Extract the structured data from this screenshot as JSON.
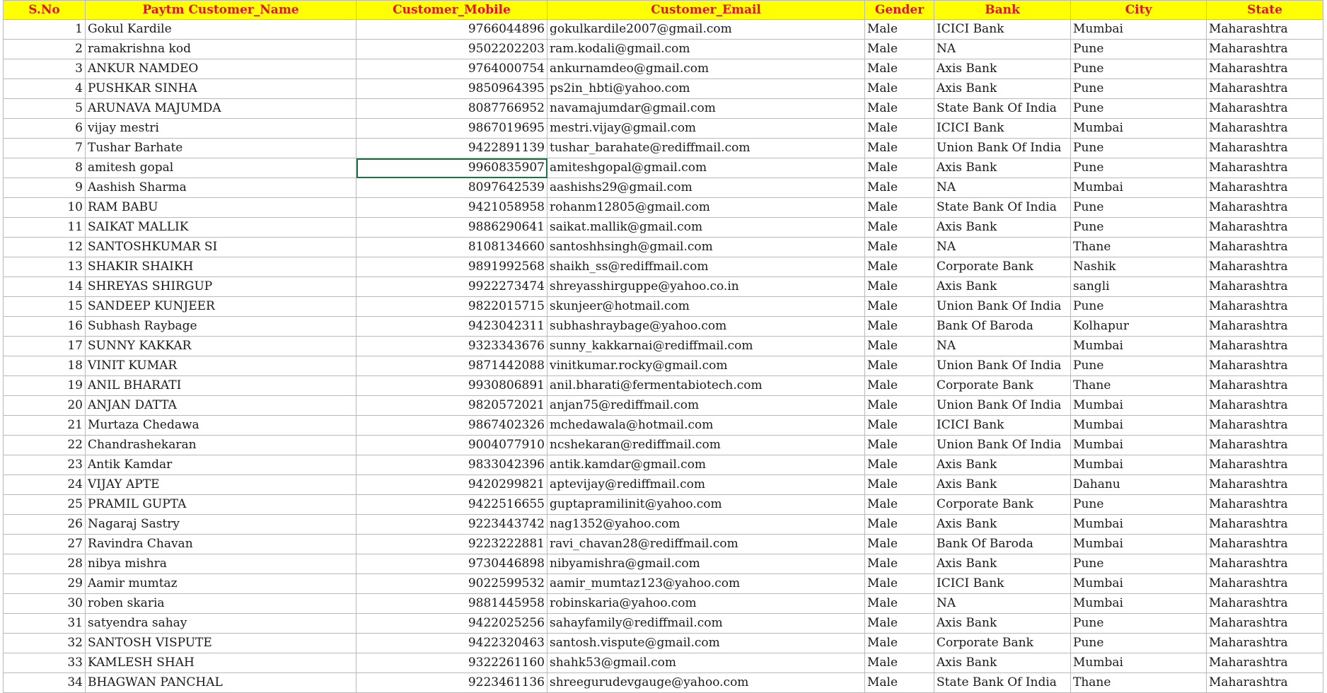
{
  "headers": [
    "S.No",
    "Paytm Customer_Name",
    "Customer_Mobile",
    "Customer_Email",
    "Gender",
    "Bank",
    "City",
    "State"
  ],
  "selected_cell": {
    "row": 8,
    "col": 2
  },
  "rows": [
    [
      "1",
      "Gokul Kardile",
      "9766044896",
      "gokulkardile2007@gmail.com",
      "Male",
      "ICICI Bank",
      "Mumbai",
      "Maharashtra"
    ],
    [
      "2",
      "ramakrishna kod",
      "9502202203",
      "ram.kodali@gmail.com",
      "Male",
      "NA",
      "Pune",
      "Maharashtra"
    ],
    [
      "3",
      "ANKUR NAMDEO",
      "9764000754",
      "ankurnamdeo@gmail.com",
      "Male",
      "Axis Bank",
      "Pune",
      "Maharashtra"
    ],
    [
      "4",
      "PUSHKAR SINHA",
      "9850964395",
      "ps2in_hbti@yahoo.com",
      "Male",
      "Axis Bank",
      "Pune",
      "Maharashtra"
    ],
    [
      "5",
      "ARUNAVA MAJUMDA",
      "8087766952",
      "navamajumdar@gmail.com",
      "Male",
      "State Bank Of India",
      "Pune",
      "Maharashtra"
    ],
    [
      "6",
      "vijay mestri",
      "9867019695",
      "mestri.vijay@gmail.com",
      "Male",
      "ICICI Bank",
      "Mumbai",
      "Maharashtra"
    ],
    [
      "7",
      "Tushar Barhate",
      "9422891139",
      "tushar_barahate@rediffmail.com",
      "Male",
      "Union Bank Of India",
      "Pune",
      "Maharashtra"
    ],
    [
      "8",
      "amitesh gopal",
      "9960835907",
      "amiteshgopal@gmail.com",
      "Male",
      "Axis Bank",
      "Pune",
      "Maharashtra"
    ],
    [
      "9",
      "Aashish Sharma",
      "8097642539",
      "aashishs29@gmail.com",
      "Male",
      "NA",
      "Mumbai",
      "Maharashtra"
    ],
    [
      "10",
      "RAM BABU",
      "9421058958",
      "rohanm12805@gmail.com",
      "Male",
      "State Bank Of India",
      "Pune",
      "Maharashtra"
    ],
    [
      "11",
      "SAIKAT MALLIK",
      "9886290641",
      "saikat.mallik@gmail.com",
      "Male",
      "Axis Bank",
      "Pune",
      "Maharashtra"
    ],
    [
      "12",
      "SANTOSHKUMAR SI",
      "8108134660",
      "santoshhsingh@gmail.com",
      "Male",
      "NA",
      "Thane",
      "Maharashtra"
    ],
    [
      "13",
      "SHAKIR SHAIKH",
      "9891992568",
      "shaikh_ss@rediffmail.com",
      "Male",
      "Corporate Bank",
      "Nashik",
      "Maharashtra"
    ],
    [
      "14",
      "SHREYAS SHIRGUP",
      "9922273474",
      "shreyasshirguppe@yahoo.co.in",
      "Male",
      "Axis Bank",
      "sangli",
      "Maharashtra"
    ],
    [
      "15",
      "SANDEEP KUNJEER",
      "9822015715",
      "skunjeer@hotmail.com",
      "Male",
      "Union Bank Of India",
      "Pune",
      "Maharashtra"
    ],
    [
      "16",
      "Subhash Raybage",
      "9423042311",
      "subhashraybage@yahoo.com",
      "Male",
      "Bank Of Baroda",
      "Kolhapur",
      "Maharashtra"
    ],
    [
      "17",
      "SUNNY KAKKAR",
      "9323343676",
      "sunny_kakkarnai@rediffmail.com",
      "Male",
      "NA",
      "Mumbai",
      "Maharashtra"
    ],
    [
      "18",
      "VINIT KUMAR",
      "9871442088",
      "vinitkumar.rocky@gmail.com",
      "Male",
      "Union Bank Of India",
      "Pune",
      "Maharashtra"
    ],
    [
      "19",
      "ANIL BHARATI",
      "9930806891",
      "anil.bharati@fermentabiotech.com",
      "Male",
      "Corporate Bank",
      "Thane",
      "Maharashtra"
    ],
    [
      "20",
      "ANJAN DATTA",
      "9820572021",
      "anjan75@rediffmail.com",
      "Male",
      "Union Bank Of India",
      "Mumbai",
      "Maharashtra"
    ],
    [
      "21",
      "Murtaza Chedawa",
      "9867402326",
      "mchedawala@hotmail.com",
      "Male",
      "ICICI Bank",
      "Mumbai",
      "Maharashtra"
    ],
    [
      "22",
      "Chandrashekaran",
      "9004077910",
      "ncshekaran@rediffmail.com",
      "Male",
      "Union Bank Of India",
      "Mumbai",
      "Maharashtra"
    ],
    [
      "23",
      "Antik Kamdar",
      "9833042396",
      "antik.kamdar@gmail.com",
      "Male",
      "Axis Bank",
      "Mumbai",
      "Maharashtra"
    ],
    [
      "24",
      "VIJAY APTE",
      "9420299821",
      "aptevijay@rediffmail.com",
      "Male",
      "Axis Bank",
      "Dahanu",
      "Maharashtra"
    ],
    [
      "25",
      "PRAMIL GUPTA",
      "9422516655",
      "guptapramilinit@yahoo.com",
      "Male",
      "Corporate Bank",
      "Pune",
      "Maharashtra"
    ],
    [
      "26",
      "Nagaraj Sastry",
      "9223443742",
      "nag1352@yahoo.com",
      "Male",
      "Axis Bank",
      "Mumbai",
      "Maharashtra"
    ],
    [
      "27",
      "Ravindra Chavan",
      "9223222881",
      "ravi_chavan28@rediffmail.com",
      "Male",
      "Bank Of Baroda",
      "Mumbai",
      "Maharashtra"
    ],
    [
      "28",
      "nibya mishra",
      "9730446898",
      "nibyamishra@gmail.com",
      "Male",
      "Axis Bank",
      "Pune",
      "Maharashtra"
    ],
    [
      "29",
      "Aamir mumtaz",
      "9022599532",
      "aamir_mumtaz123@yahoo.com",
      "Male",
      "ICICI Bank",
      "Mumbai",
      "Maharashtra"
    ],
    [
      "30",
      "roben skaria",
      "9881445958",
      "robinskaria@yahoo.com",
      "Male",
      "NA",
      "Mumbai",
      "Maharashtra"
    ],
    [
      "31",
      "satyendra sahay",
      "9422025256",
      "sahayfamily@rediffmail.com",
      "Male",
      "Axis Bank",
      "Pune",
      "Maharashtra"
    ],
    [
      "32",
      "SANTOSH VISPUTE",
      "9422320463",
      "santosh.vispute@gmail.com",
      "Male",
      "Corporate Bank",
      "Pune",
      "Maharashtra"
    ],
    [
      "33",
      "KAMLESH SHAH",
      "9322261160",
      "shahk53@gmail.com",
      "Male",
      "Axis Bank",
      "Mumbai",
      "Maharashtra"
    ],
    [
      "34",
      "BHAGWAN PANCHAL",
      "9223461136",
      "shreegurudevgauge@yahoo.com",
      "Male",
      "State Bank Of India",
      "Thane",
      "Maharashtra"
    ]
  ]
}
